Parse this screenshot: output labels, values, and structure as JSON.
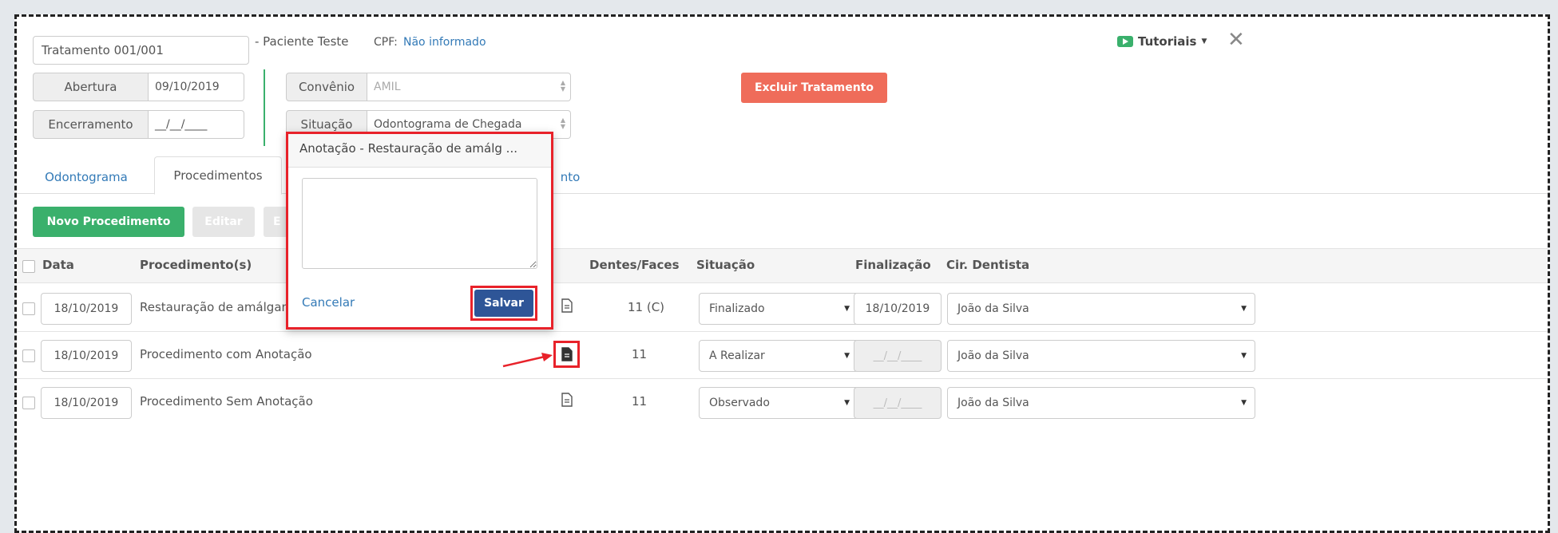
{
  "header": {
    "treatment_value": "Tratamento 001/001",
    "patient_label": "- Paciente Teste",
    "cpf_label": "CPF:",
    "cpf_value": "Não informado",
    "tutorials_label": "Tutoriais",
    "close_symbol": "✕"
  },
  "dates": {
    "abertura_label": "Abertura",
    "abertura_value": "09/10/2019",
    "encerramento_label": "Encerramento",
    "encerramento_value": "__/__/____"
  },
  "fields": {
    "convenio_label": "Convênio",
    "convenio_value": "AMIL",
    "situacao_label": "Situação",
    "situacao_value": "Odontograma de Chegada"
  },
  "buttons": {
    "excluir": "Excluir Tratamento",
    "novo": "Novo Procedimento",
    "editar": "Editar",
    "third": "E"
  },
  "tabs": [
    {
      "label": "Odontograma"
    },
    {
      "label": "Procedimentos"
    },
    {
      "label": "nto"
    }
  ],
  "table": {
    "headers": {
      "data": "Data",
      "procedimentos": "Procedimento(s)",
      "dentes": "Dentes/Faces",
      "situacao": "Situação",
      "finalizacao": "Finalização",
      "dentista": "Cir. Dentista"
    },
    "rows": [
      {
        "date": "18/10/2019",
        "procedure": "Restauração de amálgama",
        "teeth": "11  (C)",
        "status": "Finalizado",
        "finalizacao": "18/10/2019",
        "dentist": "João da Silva"
      },
      {
        "date": "18/10/2019",
        "procedure": "Procedimento com Anotação",
        "teeth": "11",
        "status": "A Realizar",
        "finalizacao": "__/__/____",
        "dentist": "João da Silva"
      },
      {
        "date": "18/10/2019",
        "procedure": "Procedimento Sem Anotação",
        "teeth": "11",
        "status": "Observado",
        "finalizacao": "__/__/____",
        "dentist": "João da Silva"
      }
    ]
  },
  "modal": {
    "title": "Anotação - Restauração de amálg ...",
    "textarea_value": "",
    "cancel": "Cancelar",
    "save": "Salvar"
  },
  "colors": {
    "danger": "#ef6c5a",
    "success": "#3ab06c",
    "primary": "#2e5597",
    "highlight": "#e8222a",
    "link": "#337ab7"
  }
}
